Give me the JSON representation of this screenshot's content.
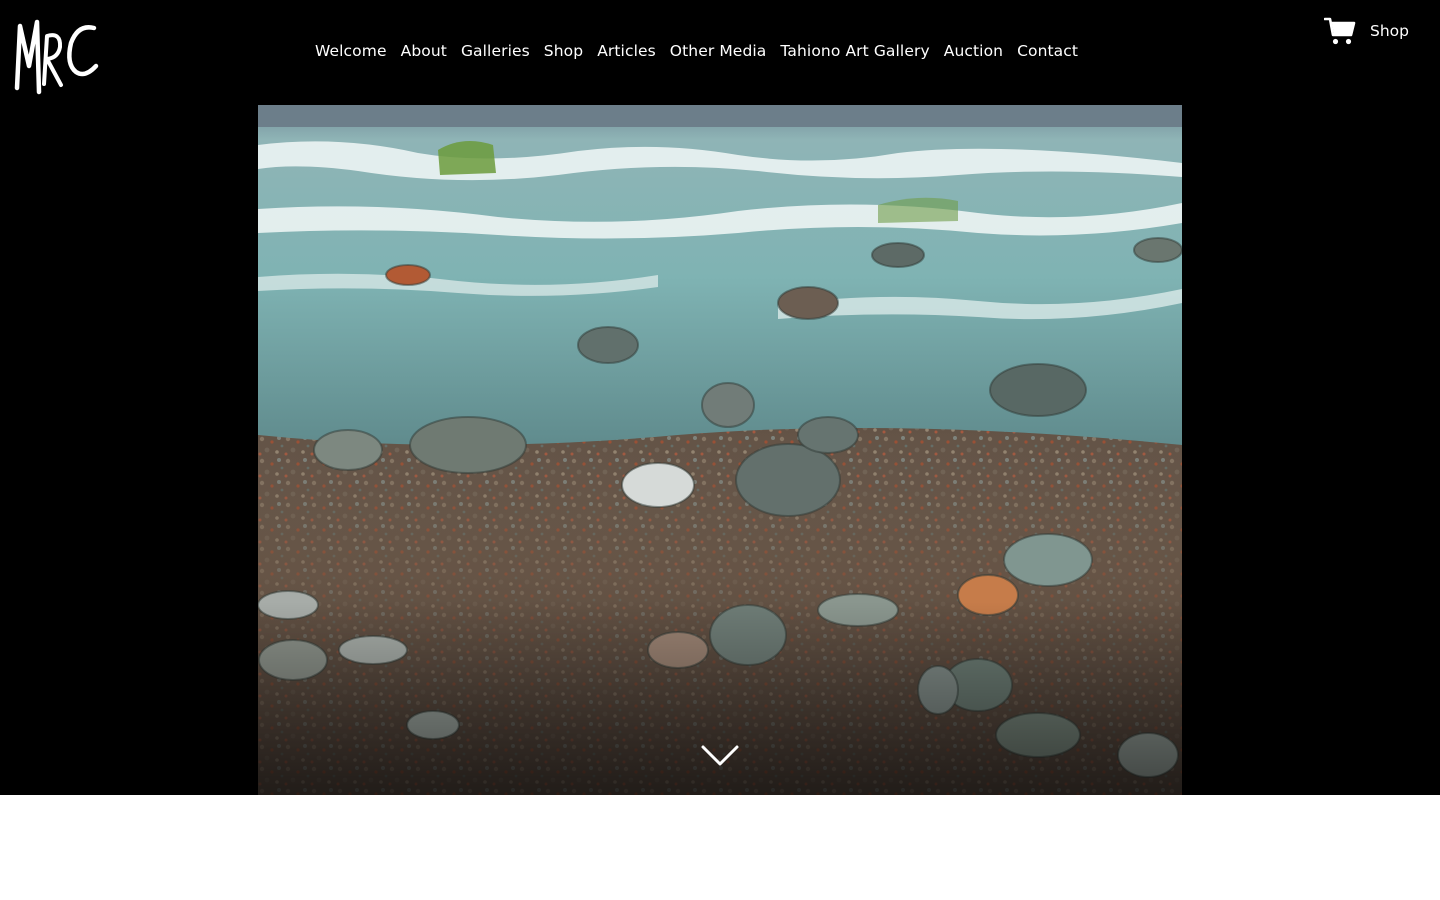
{
  "header": {
    "logo_text": "MRC",
    "nav": [
      {
        "label": "Welcome"
      },
      {
        "label": "About"
      },
      {
        "label": "Galleries"
      },
      {
        "label": "Shop"
      },
      {
        "label": "Articles"
      },
      {
        "label": "Other Media"
      },
      {
        "label": "Tahiono Art Gallery"
      },
      {
        "label": "Auction"
      },
      {
        "label": "Contact"
      }
    ],
    "cart": {
      "label": "Shop",
      "icon": "shopping-cart-icon"
    }
  },
  "hero": {
    "image": "seashore-rocks-painting",
    "scroll_icon": "chevron-down-icon"
  },
  "colors": {
    "header_bg": "#000000",
    "text": "#ffffff",
    "page_bg": "#ffffff"
  }
}
